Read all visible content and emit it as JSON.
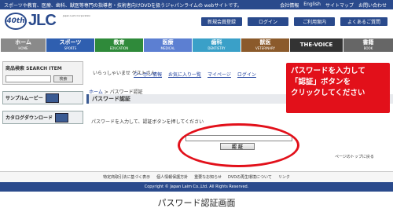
{
  "topbar": {
    "tagline": "スポーツや教育、医療、歯科、獣医等専門の指導者・技術者向けDVDを扱うジャパンライムの webサイトです。",
    "links": [
      "会社情報",
      "English",
      "サイトマップ",
      "お問い合わせ"
    ]
  },
  "header": {
    "badge": "40th",
    "logo": "JLC",
    "logo_sub": "Japan Laim Corporation",
    "buttons": [
      "新規会員登録",
      "ログイン",
      "ご利用案内",
      "よくあるご質問"
    ]
  },
  "nav": {
    "tabs": [
      {
        "jp": "ホーム",
        "en": "HOME",
        "color": "#8a8a8a"
      },
      {
        "jp": "スポーツ",
        "en": "SPORTS",
        "color": "#2f5fb0"
      },
      {
        "jp": "教育",
        "en": "EDUCATION",
        "color": "#2f8a3a"
      },
      {
        "jp": "医療",
        "en": "MEDICAL",
        "color": "#5c7fd2"
      },
      {
        "jp": "歯科",
        "en": "DENTISTRY",
        "color": "#3aa0c8"
      },
      {
        "jp": "獣医",
        "en": "VETERINARY",
        "color": "#8b5a2b"
      },
      {
        "jp": "THE-VOICE",
        "en": "",
        "color": "#333333"
      },
      {
        "jp": "書籍",
        "en": "BOOK",
        "color": "#666666"
      }
    ]
  },
  "sidebar": {
    "search_title": "商品検索  SEARCH ITEM",
    "search_button": "検索",
    "sample_movie": "サンプルムービー",
    "catalog_download": "カタログダウンロード"
  },
  "main": {
    "greeting": "いらっしゃいませ ゲストさん",
    "links": [
      "クーポン情報",
      "お気に入り一覧",
      "マイページ",
      "ログイン"
    ],
    "breadcrumb_home": "ホーム",
    "breadcrumb_sep": " > ",
    "breadcrumb_current": "パスワード認証",
    "page_title": "パスワード認証",
    "instruction": "パスワードを入力して、認証ボタンを押してください",
    "auth_button": "認 証",
    "page_top": "ページのトップに戻る"
  },
  "callout": {
    "line1": "パスワードを入力して",
    "line2": "「認証」ボタンを",
    "line3": "クリックしてください"
  },
  "footer": {
    "links": [
      "特定商取引法に基づく表示",
      "個人情報保護方針",
      "重要なお知らせ",
      "DVDの再生環境について",
      "リンク"
    ],
    "copyright": "Copyright © Japan Laim Co.,Ltd. All Rights Reserved."
  },
  "caption": "パスワード認証画面"
}
